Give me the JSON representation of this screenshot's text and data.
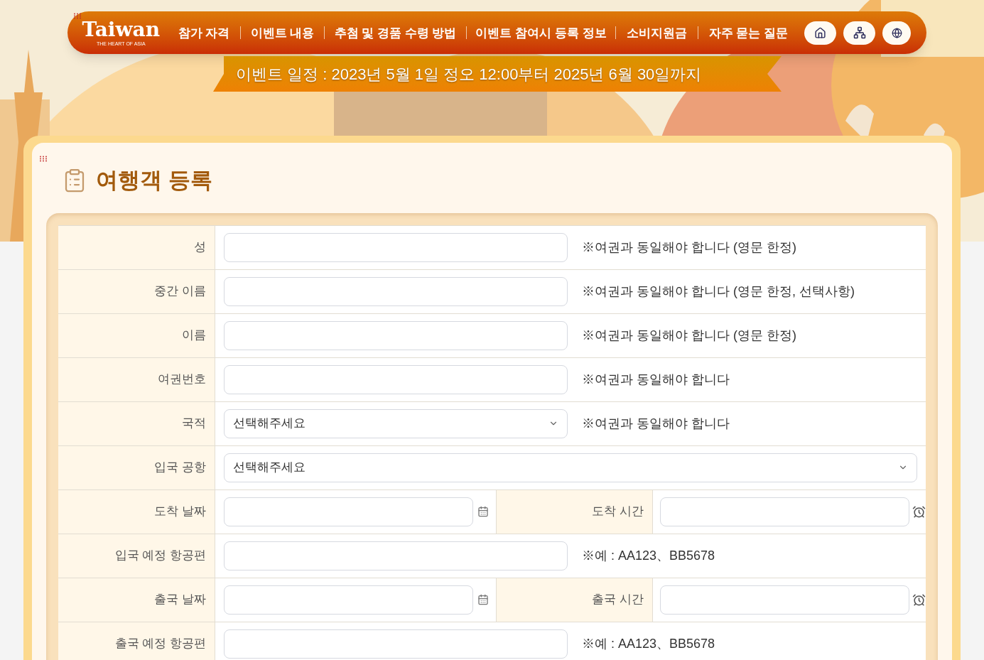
{
  "header": {
    "logo": {
      "title": "Taiwan",
      "tagline": "THE HEART OF ASIA"
    },
    "nav": [
      "참가 자격",
      "이벤트 내용",
      "추첨 및 경품 수령 방법",
      "이벤트 참여시 등록 정보",
      "소비지원금",
      "자주 묻는 질문"
    ],
    "event_banner": "이벤트 일정 : 2023년 5월 1일 정오 12:00부터 2025년 6월 30일까지"
  },
  "form": {
    "title": "여행객 등록",
    "rows": [
      {
        "kind": "text",
        "label": "성",
        "note": "※여권과 동일해야 합니다 (영문 한정)"
      },
      {
        "kind": "text",
        "label": "중간 이름",
        "note": "※여권과 동일해야 합니다 (영문 한정, 선택사항)"
      },
      {
        "kind": "text",
        "label": "이름",
        "note": "※여권과 동일해야 합니다 (영문 한정)"
      },
      {
        "kind": "text",
        "label": "여권번호",
        "note": "※여권과 동일해야 합니다"
      },
      {
        "kind": "select",
        "label": "국적",
        "value": "선택해주세요",
        "note": "※여권과 동일해야 합니다"
      },
      {
        "kind": "select",
        "label": "입국 공항",
        "value": "선택해주세요"
      },
      {
        "kind": "datetime",
        "label": "도착 날짜",
        "time_label": "도착 시간"
      },
      {
        "kind": "text",
        "label": "입국 예정 항공편",
        "note": "※예 : AA123、BB5678"
      },
      {
        "kind": "datetime",
        "label": "출국 날짜",
        "time_label": "출국 시간"
      },
      {
        "kind": "text",
        "label": "출국 예정 항공편",
        "note": "※예 : AA123、BB5678"
      }
    ]
  }
}
